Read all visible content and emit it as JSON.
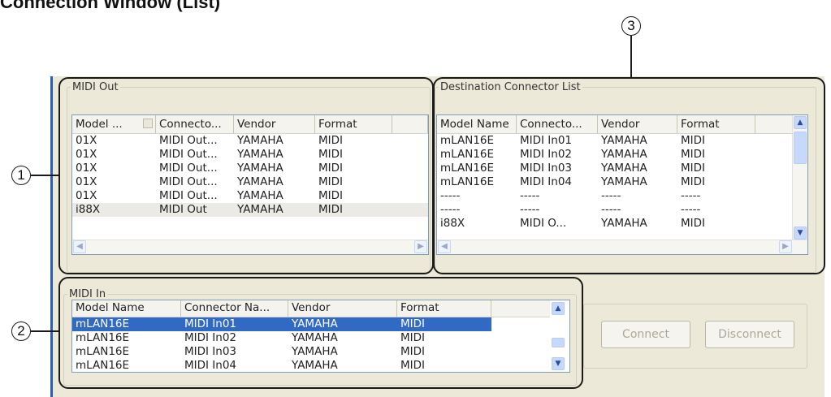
{
  "heading": "Connection Window (List)",
  "callout_markers": [
    "1",
    "2",
    "3"
  ],
  "midi_out": {
    "group_title": "MIDI Out",
    "columns": [
      "Model ...",
      "Connecto...",
      "Vendor",
      "Format"
    ],
    "rows": [
      [
        "01X",
        "MIDI Out...",
        "YAMAHA",
        "MIDI"
      ],
      [
        "01X",
        "MIDI Out...",
        "YAMAHA",
        "MIDI"
      ],
      [
        "01X",
        "MIDI Out...",
        "YAMAHA",
        "MIDI"
      ],
      [
        "01X",
        "MIDI Out...",
        "YAMAHA",
        "MIDI"
      ],
      [
        "01X",
        "MIDI Out...",
        "YAMAHA",
        "MIDI"
      ],
      [
        "i88X",
        "MIDI Out",
        "YAMAHA",
        "MIDI"
      ]
    ],
    "selected_row": 5
  },
  "destination": {
    "group_title": "Destination Connector List",
    "columns": [
      "Model Name",
      "Connecto...",
      "Vendor",
      "Format"
    ],
    "rows": [
      [
        "mLAN16E",
        "MIDI In01",
        "YAMAHA",
        "MIDI"
      ],
      [
        "mLAN16E",
        "MIDI In02",
        "YAMAHA",
        "MIDI"
      ],
      [
        "mLAN16E",
        "MIDI In03",
        "YAMAHA",
        "MIDI"
      ],
      [
        "mLAN16E",
        "MIDI In04",
        "YAMAHA",
        "MIDI"
      ],
      [
        "-----",
        "-----",
        "-----",
        "-----"
      ],
      [
        "-----",
        "-----",
        "-----",
        "-----"
      ],
      [
        "i88X",
        "MIDI O...",
        "YAMAHA",
        "MIDI"
      ]
    ]
  },
  "midi_in": {
    "group_title": "MIDI In",
    "columns": [
      "Model Name",
      "Connector Na...",
      "Vendor",
      "Format"
    ],
    "rows": [
      [
        "mLAN16E",
        "MIDI In01",
        "YAMAHA",
        "MIDI"
      ],
      [
        "mLAN16E",
        "MIDI In02",
        "YAMAHA",
        "MIDI"
      ],
      [
        "mLAN16E",
        "MIDI In03",
        "YAMAHA",
        "MIDI"
      ],
      [
        "mLAN16E",
        "MIDI In04",
        "YAMAHA",
        "MIDI"
      ]
    ],
    "selected_row": 0
  },
  "actions": {
    "connect_label": "Connect",
    "disconnect_label": "Disconnect",
    "enabled": false
  },
  "colors": {
    "selection_blue": "#316ac5",
    "window_face": "#ece9d8",
    "disabled_text": "#aca899"
  }
}
